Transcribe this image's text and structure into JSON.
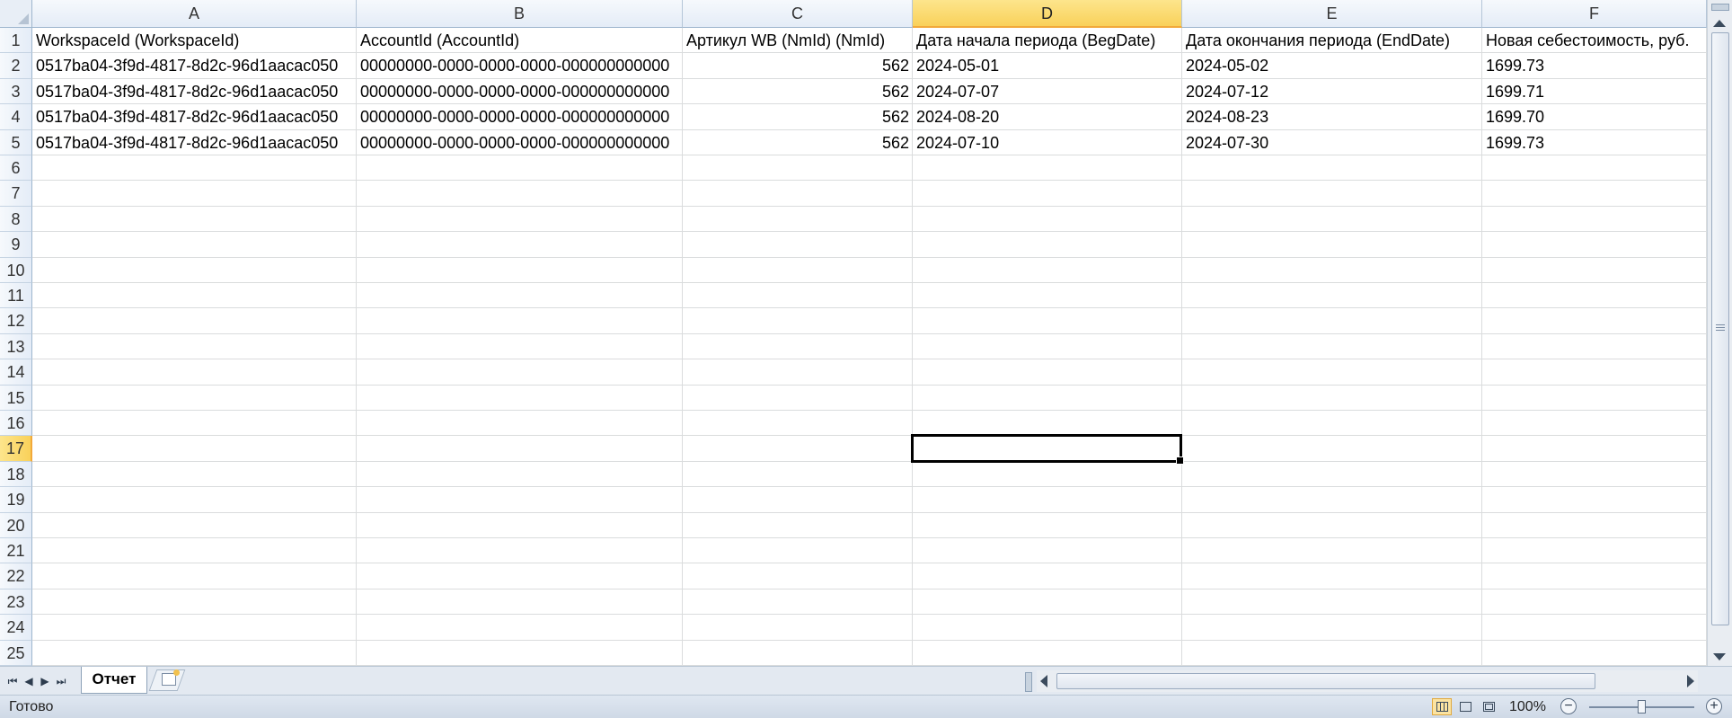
{
  "sheet": {
    "column_headers": [
      "A",
      "B",
      "C",
      "D",
      "E",
      "F"
    ],
    "selected_column": "D",
    "row_numbers": [
      "1",
      "2",
      "3",
      "4",
      "5",
      "6",
      "7",
      "8",
      "9",
      "10",
      "11",
      "12",
      "13",
      "14",
      "15",
      "16",
      "17",
      "18",
      "19",
      "20",
      "21",
      "22",
      "23",
      "24",
      "25"
    ],
    "selected_row": "17",
    "active_cell": "D17",
    "rows": [
      [
        "WorkspaceId (WorkspaceId)",
        "AccountId (AccountId)",
        "Артикул WB (NmId) (NmId)",
        "Дата начала периода (BegDate)",
        "Дата окончания периода (EndDate)",
        "Новая себестоимость, руб."
      ],
      [
        "0517ba04-3f9d-4817-8d2c-96d1aacac050",
        "00000000-0000-0000-0000-000000000000",
        "562",
        "2024-05-01",
        "2024-05-02",
        "1699.73"
      ],
      [
        "0517ba04-3f9d-4817-8d2c-96d1aacac050",
        "00000000-0000-0000-0000-000000000000",
        "562",
        "2024-07-07",
        "2024-07-12",
        "1699.71"
      ],
      [
        "0517ba04-3f9d-4817-8d2c-96d1aacac050",
        "00000000-0000-0000-0000-000000000000",
        "562",
        "2024-08-20",
        "2024-08-23",
        "1699.70"
      ],
      [
        "0517ba04-3f9d-4817-8d2c-96d1aacac050",
        "00000000-0000-0000-0000-000000000000",
        "562",
        "2024-07-10",
        "2024-07-30",
        "1699.73"
      ]
    ]
  },
  "tabs": {
    "sheet_tab_label": "Отчет"
  },
  "status": {
    "text": "Готово",
    "zoom_label": "100%",
    "zoom_percent": 100,
    "minus_glyph": "−",
    "plus_glyph": "+"
  },
  "icons": {
    "nav_first": "⏮",
    "nav_prev": "◀",
    "nav_next": "▶",
    "nav_last": "⏭",
    "view_normal": "normal-view-icon",
    "view_layout": "page-layout-icon",
    "view_break": "page-break-icon"
  },
  "colors": {
    "selected_header": "#f9d15a",
    "gridline": "#dadcdd",
    "header_bg": "#e4ecf7"
  }
}
